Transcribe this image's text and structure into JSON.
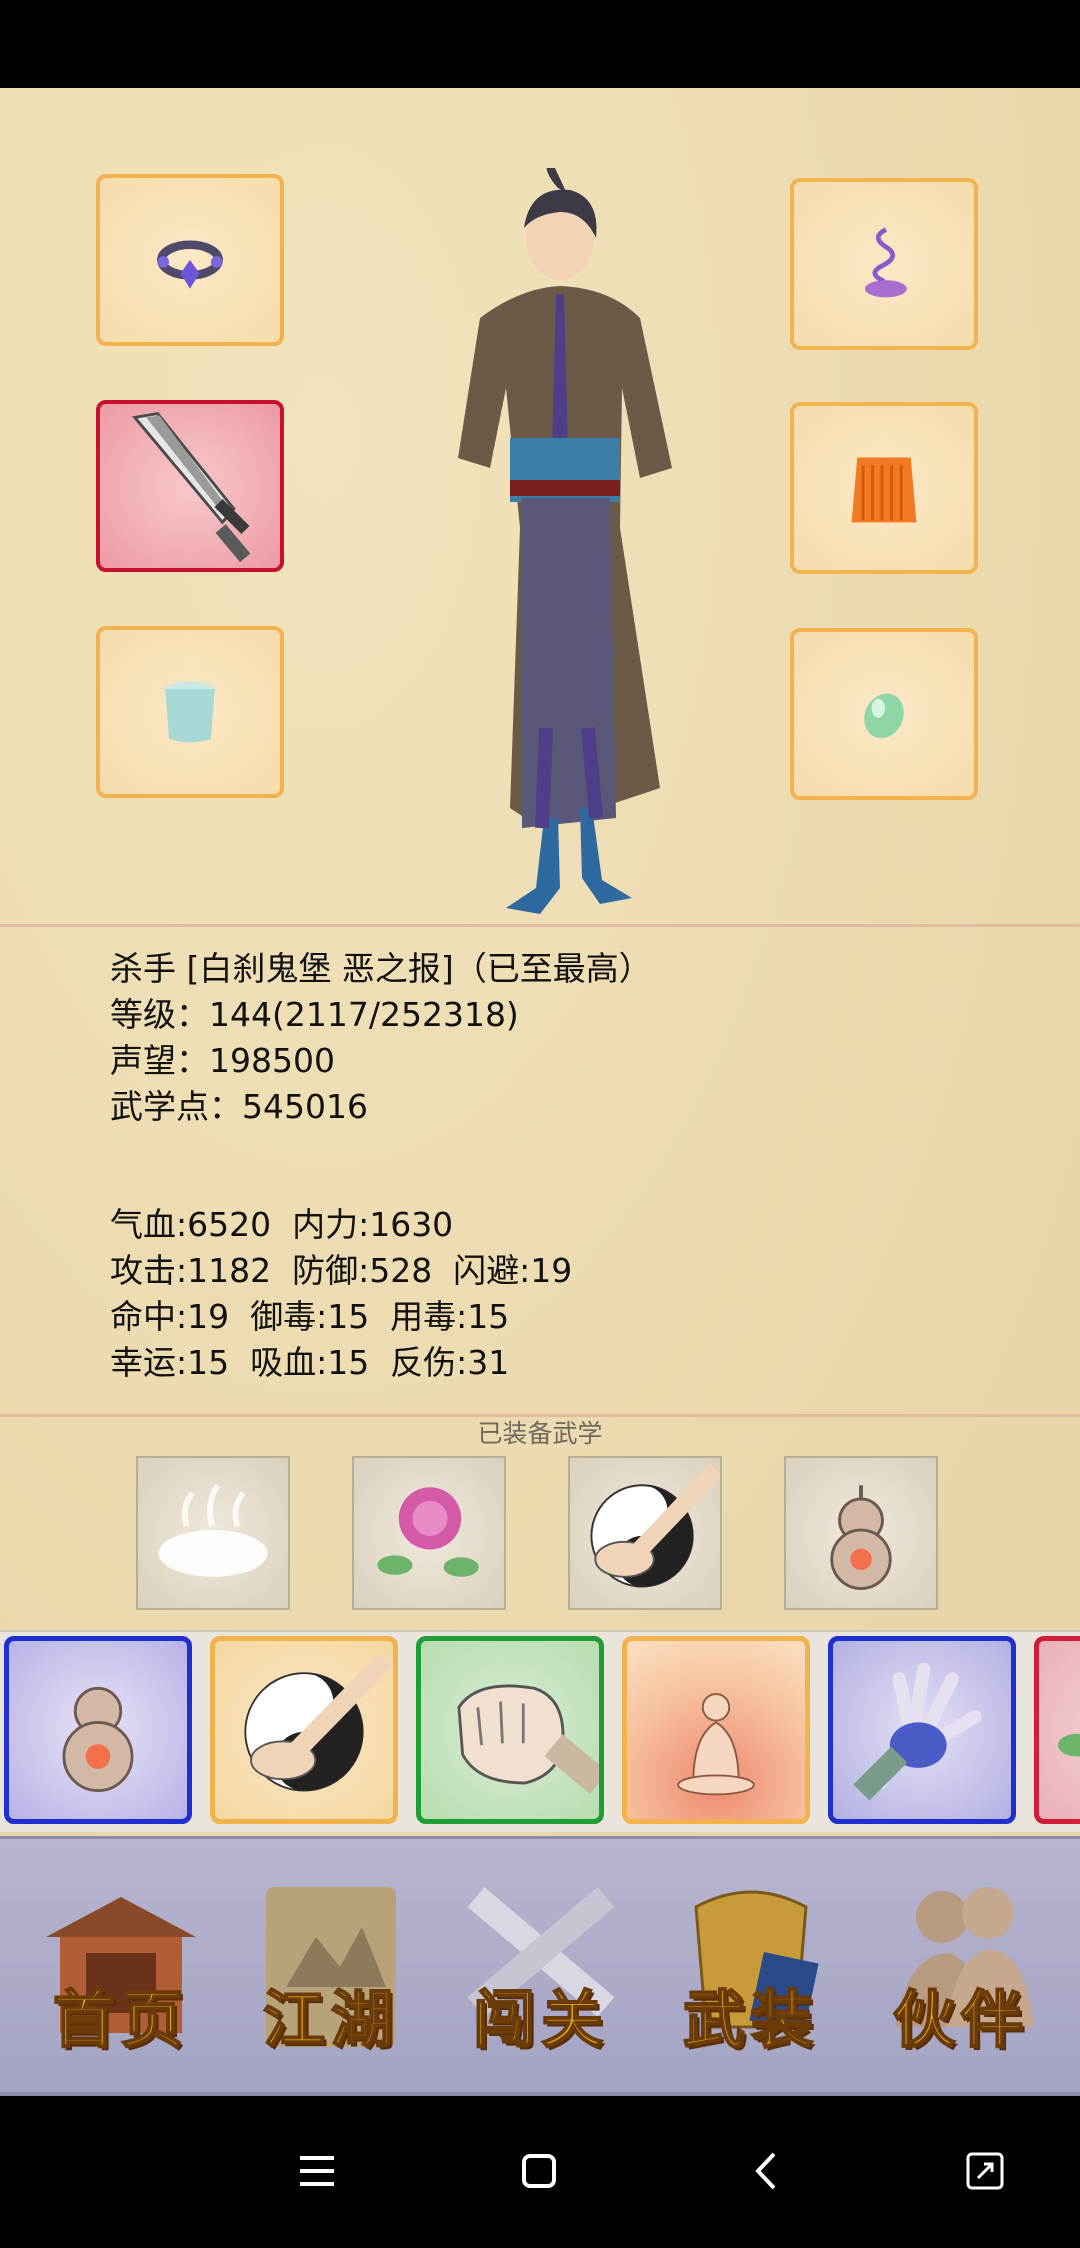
{
  "character": {
    "title_line": "杀手 [白刹鬼堡 恶之报]（已至最高）",
    "level_line": "等级：144(2117/252318)",
    "reputation_line": "声望：198500",
    "martial_points_line": "武学点：545016"
  },
  "stats": {
    "row1": "气血:6520  内力:1630",
    "row2": "攻击:1182  防御:528  闪避:19",
    "row3": "命中:19  御毒:15  用毒:15",
    "row4": "幸运:15  吸血:15  反伤:31"
  },
  "equipped_martial_label": "已装备武学",
  "equipment_slots": [
    "ring-icon",
    "saber-icon",
    "cup-icon",
    "incense-icon",
    "robe-icon",
    "jade-icon"
  ],
  "equipped_skills": [
    "mist-icon",
    "rose-icon",
    "taiji-palm-icon",
    "gourd-icon"
  ],
  "skill_cards": [
    {
      "icon": "gourd-icon",
      "border": "#1f2fd0"
    },
    {
      "icon": "taiji-palm-icon",
      "border": "#f3b24e"
    },
    {
      "icon": "fist-icon",
      "border": "#1e9e33"
    },
    {
      "icon": "meditation-icon",
      "border": "#f3b24e"
    },
    {
      "icon": "claw-hand-icon",
      "border": "#1f2fd0"
    },
    {
      "icon": "partial-card-icon",
      "border": "#d01e3a"
    }
  ],
  "nav": {
    "home": "首页",
    "jianghu": "江湖",
    "challenge": "闯关",
    "equipment": "武装",
    "partner": "伙伴"
  },
  "colors": {
    "slot_border": "#f3b24e",
    "selected_slot_border": "#c8102e",
    "nav_text": "#f3b51c"
  }
}
